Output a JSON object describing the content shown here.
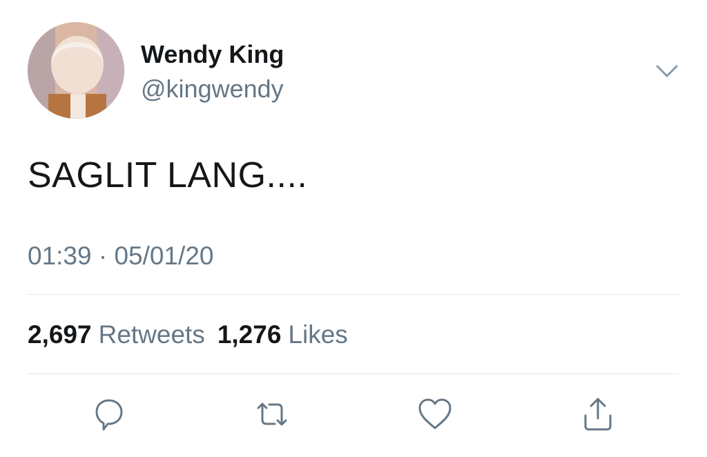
{
  "user": {
    "name": "Wendy King",
    "handle": "@kingwendy"
  },
  "tweet": {
    "text": "SAGLIT LANG....",
    "timestamp": "01:39 · 05/01/20"
  },
  "stats": {
    "retweets_count": "2,697",
    "retweets_label": "Retweets",
    "likes_count": "1,276",
    "likes_label": "Likes"
  },
  "icons": {
    "menu": "chevron-down-icon",
    "reply": "reply-icon",
    "retweet": "retweet-icon",
    "like": "heart-icon",
    "share": "share-icon"
  },
  "colors": {
    "text": "#14171a",
    "secondary": "#657786",
    "divider": "#e1e8ed"
  }
}
